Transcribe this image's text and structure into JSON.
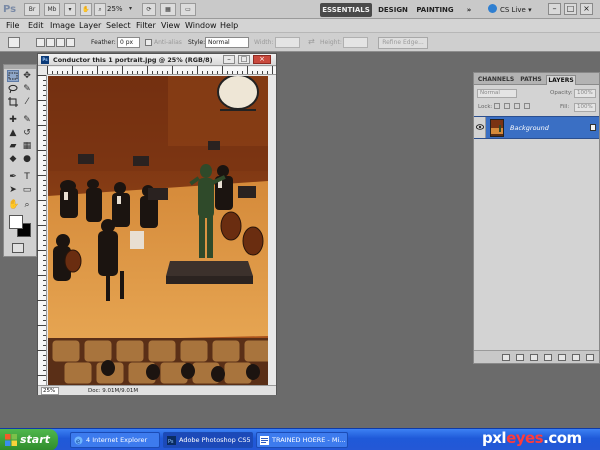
{
  "app": {
    "logo": "Ps",
    "zoom": "25%",
    "workspaces": [
      "ESSENTIALS",
      "DESIGN",
      "PAINTING"
    ],
    "more": "»",
    "cs_live": "CS Live",
    "cs_live_caret": "▾"
  },
  "menu": [
    "File",
    "Edit",
    "Image",
    "Layer",
    "Select",
    "Filter",
    "View",
    "Window",
    "Help"
  ],
  "options": {
    "feather_label": "Feather:",
    "feather_value": "0 px",
    "antialias_label": "Anti-alias",
    "style_label": "Style:",
    "style_value": "Normal",
    "width_label": "Width:",
    "height_label": "Height:",
    "refine_edge": "Refine Edge..."
  },
  "document": {
    "title": "Conductor this 1 portrait.jpg @ 25% (RGB/8)",
    "zoom": "25%",
    "info": "Doc: 9.01M/9.01M"
  },
  "layers_panel": {
    "tabs": [
      "CHANNELS",
      "PATHS",
      "LAYERS"
    ],
    "blend_mode": "Normal",
    "opacity_label": "Opacity:",
    "opacity_value": "100%",
    "lock_label": "Lock:",
    "fill_label": "Fill:",
    "fill_value": "100%",
    "layer_name": "Background"
  },
  "taskbar": {
    "start": "start",
    "tasks": [
      "4 Internet Explorer",
      "Adobe Photoshop CS5",
      "TRAINED HOERE - Mi..."
    ]
  },
  "watermark": {
    "main": "pxl",
    "accent": "eyes",
    "suffix": ".com"
  }
}
